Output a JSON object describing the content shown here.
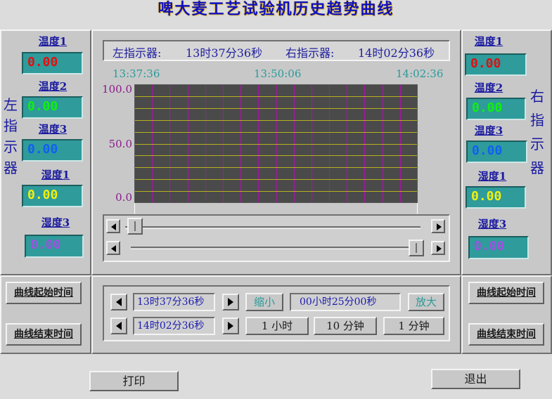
{
  "title": "啤大麦工艺试验机历史趋势曲线",
  "header": {
    "left_label": "左指示器:",
    "left_time": "13时37分36秒",
    "right_label": "右指示器:",
    "right_time": "14时02分36秒"
  },
  "chart": {
    "time_left": "13:37:36",
    "time_mid": "13:50:06",
    "time_right": "14:02:36",
    "y_top": "100.0",
    "y_mid": "50.0",
    "y_bottom": "0.0"
  },
  "left_panel": {
    "vertical_text": [
      "左",
      "指",
      "示",
      "器"
    ],
    "items": [
      {
        "label": "温度1",
        "value": "0.00",
        "color": "#e01010"
      },
      {
        "label": "温度2",
        "value": "0.00",
        "color": "#10f010"
      },
      {
        "label": "温度3",
        "value": "0.00",
        "color": "#1060f0"
      },
      {
        "label": "湿度1",
        "value": "0.00",
        "color": "#f0f010"
      },
      {
        "label": "湿度3",
        "value": "0.00",
        "color": "#a050e0"
      }
    ],
    "start_btn": "曲线起始时间",
    "end_btn": "曲线结束时间"
  },
  "right_panel": {
    "vertical_text": [
      "右",
      "指",
      "示",
      "器"
    ],
    "items": [
      {
        "label": "温度1",
        "value": "0.00",
        "color": "#e01010"
      },
      {
        "label": "温度2",
        "value": "0.00",
        "color": "#10f010"
      },
      {
        "label": "温度3",
        "value": "0.00",
        "color": "#1060f0"
      },
      {
        "label": "湿度1",
        "value": "0.00",
        "color": "#f0f010"
      },
      {
        "label": "湿度3",
        "value": "0.00",
        "color": "#a050e0"
      }
    ],
    "start_btn": "曲线起始时间",
    "end_btn": "曲线结束时间"
  },
  "controls": {
    "start_time": "13时37分36秒",
    "end_time": "14时02分36秒",
    "zoom_out": "缩小",
    "span": "00小时25分00秒",
    "zoom_in": "放大",
    "btn_1h": "1 小时",
    "btn_10m": "10 分钟",
    "btn_1m": "1 分钟"
  },
  "footer": {
    "print": "打印",
    "exit": "退出"
  },
  "sliders": {
    "top_position": 0.0,
    "bottom_position": 1.0
  }
}
